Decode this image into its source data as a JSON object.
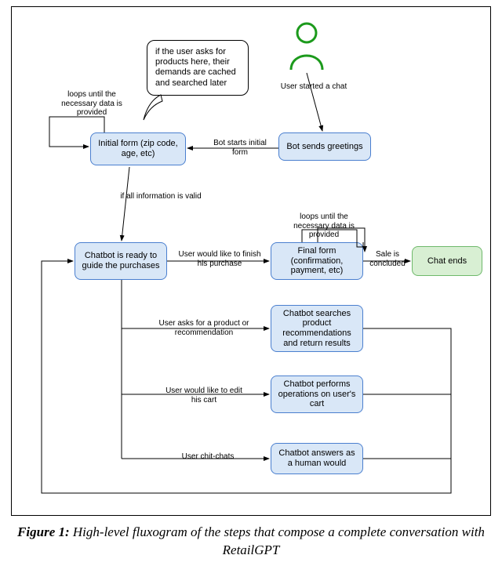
{
  "caption": {
    "fignum": "Figure 1:",
    "text": " High-level fluxogram of the steps that compose a complete conversation with RetailGPT"
  },
  "nodes": {
    "speech": "if the user asks for products here, their demands are cached and searched later",
    "initial_form": "Initial form\n(zip code, age, etc)",
    "greetings": "Bot sends greetings",
    "ready": "Chatbot is ready to guide the purchases",
    "final_form": "Final form (confirmation, payment, etc)",
    "chat_ends": "Chat ends",
    "search": "Chatbot searches product recommendations and return results",
    "cart_ops": "Chatbot performs operations on user's cart",
    "chitchat": "Chatbot answers as a human would"
  },
  "labels": {
    "loop_initial": "loops until the necessary data is provided",
    "user_started": "User started a chat",
    "bot_starts": "Bot starts initial form",
    "all_valid": "if all information is valid",
    "finish_purchase": "User would like to finish his purchase",
    "loop_final": "loops until the necessary data is provided",
    "sale_concluded": "Sale is concluded",
    "asks_product": "User asks for a product or recommendation",
    "edit_cart": "User would like to edit his cart",
    "chit_chats": "User chit-chats"
  },
  "chart_data": {
    "type": "flowchart",
    "nodes": [
      {
        "id": "user",
        "kind": "actor",
        "label": "User"
      },
      {
        "id": "greetings",
        "kind": "process",
        "label": "Bot sends greetings"
      },
      {
        "id": "initial_form",
        "kind": "process",
        "label": "Initial form (zip code, age, etc)"
      },
      {
        "id": "ready",
        "kind": "process",
        "label": "Chatbot is ready to guide the purchases"
      },
      {
        "id": "final_form",
        "kind": "process",
        "label": "Final form (confirmation, payment, etc)"
      },
      {
        "id": "chat_ends",
        "kind": "terminal",
        "label": "Chat ends"
      },
      {
        "id": "search",
        "kind": "process",
        "label": "Chatbot searches product recommendations and return results"
      },
      {
        "id": "cart_ops",
        "kind": "process",
        "label": "Chatbot performs operations on user's cart"
      },
      {
        "id": "chitchat",
        "kind": "process",
        "label": "Chatbot answers as a human would"
      }
    ],
    "edges": [
      {
        "from": "user",
        "to": "greetings",
        "label": "User started a chat"
      },
      {
        "from": "greetings",
        "to": "initial_form",
        "label": "Bot starts initial form"
      },
      {
        "from": "initial_form",
        "to": "initial_form",
        "label": "loops until the necessary data is provided"
      },
      {
        "from": "initial_form",
        "to": "ready",
        "label": "if all information is valid"
      },
      {
        "from": "initial_form",
        "note": "if the user asks for products here, their demands are cached and searched later"
      },
      {
        "from": "ready",
        "to": "final_form",
        "label": "User would like to finish his purchase"
      },
      {
        "from": "final_form",
        "to": "final_form",
        "label": "loops until the necessary data is provided"
      },
      {
        "from": "final_form",
        "to": "chat_ends",
        "label": "Sale is concluded"
      },
      {
        "from": "ready",
        "to": "search",
        "label": "User asks for a product or recommendation"
      },
      {
        "from": "search",
        "to": "ready"
      },
      {
        "from": "ready",
        "to": "cart_ops",
        "label": "User would like to edit his cart"
      },
      {
        "from": "cart_ops",
        "to": "ready"
      },
      {
        "from": "ready",
        "to": "chitchat",
        "label": "User chit-chats"
      },
      {
        "from": "chitchat",
        "to": "ready"
      }
    ]
  }
}
